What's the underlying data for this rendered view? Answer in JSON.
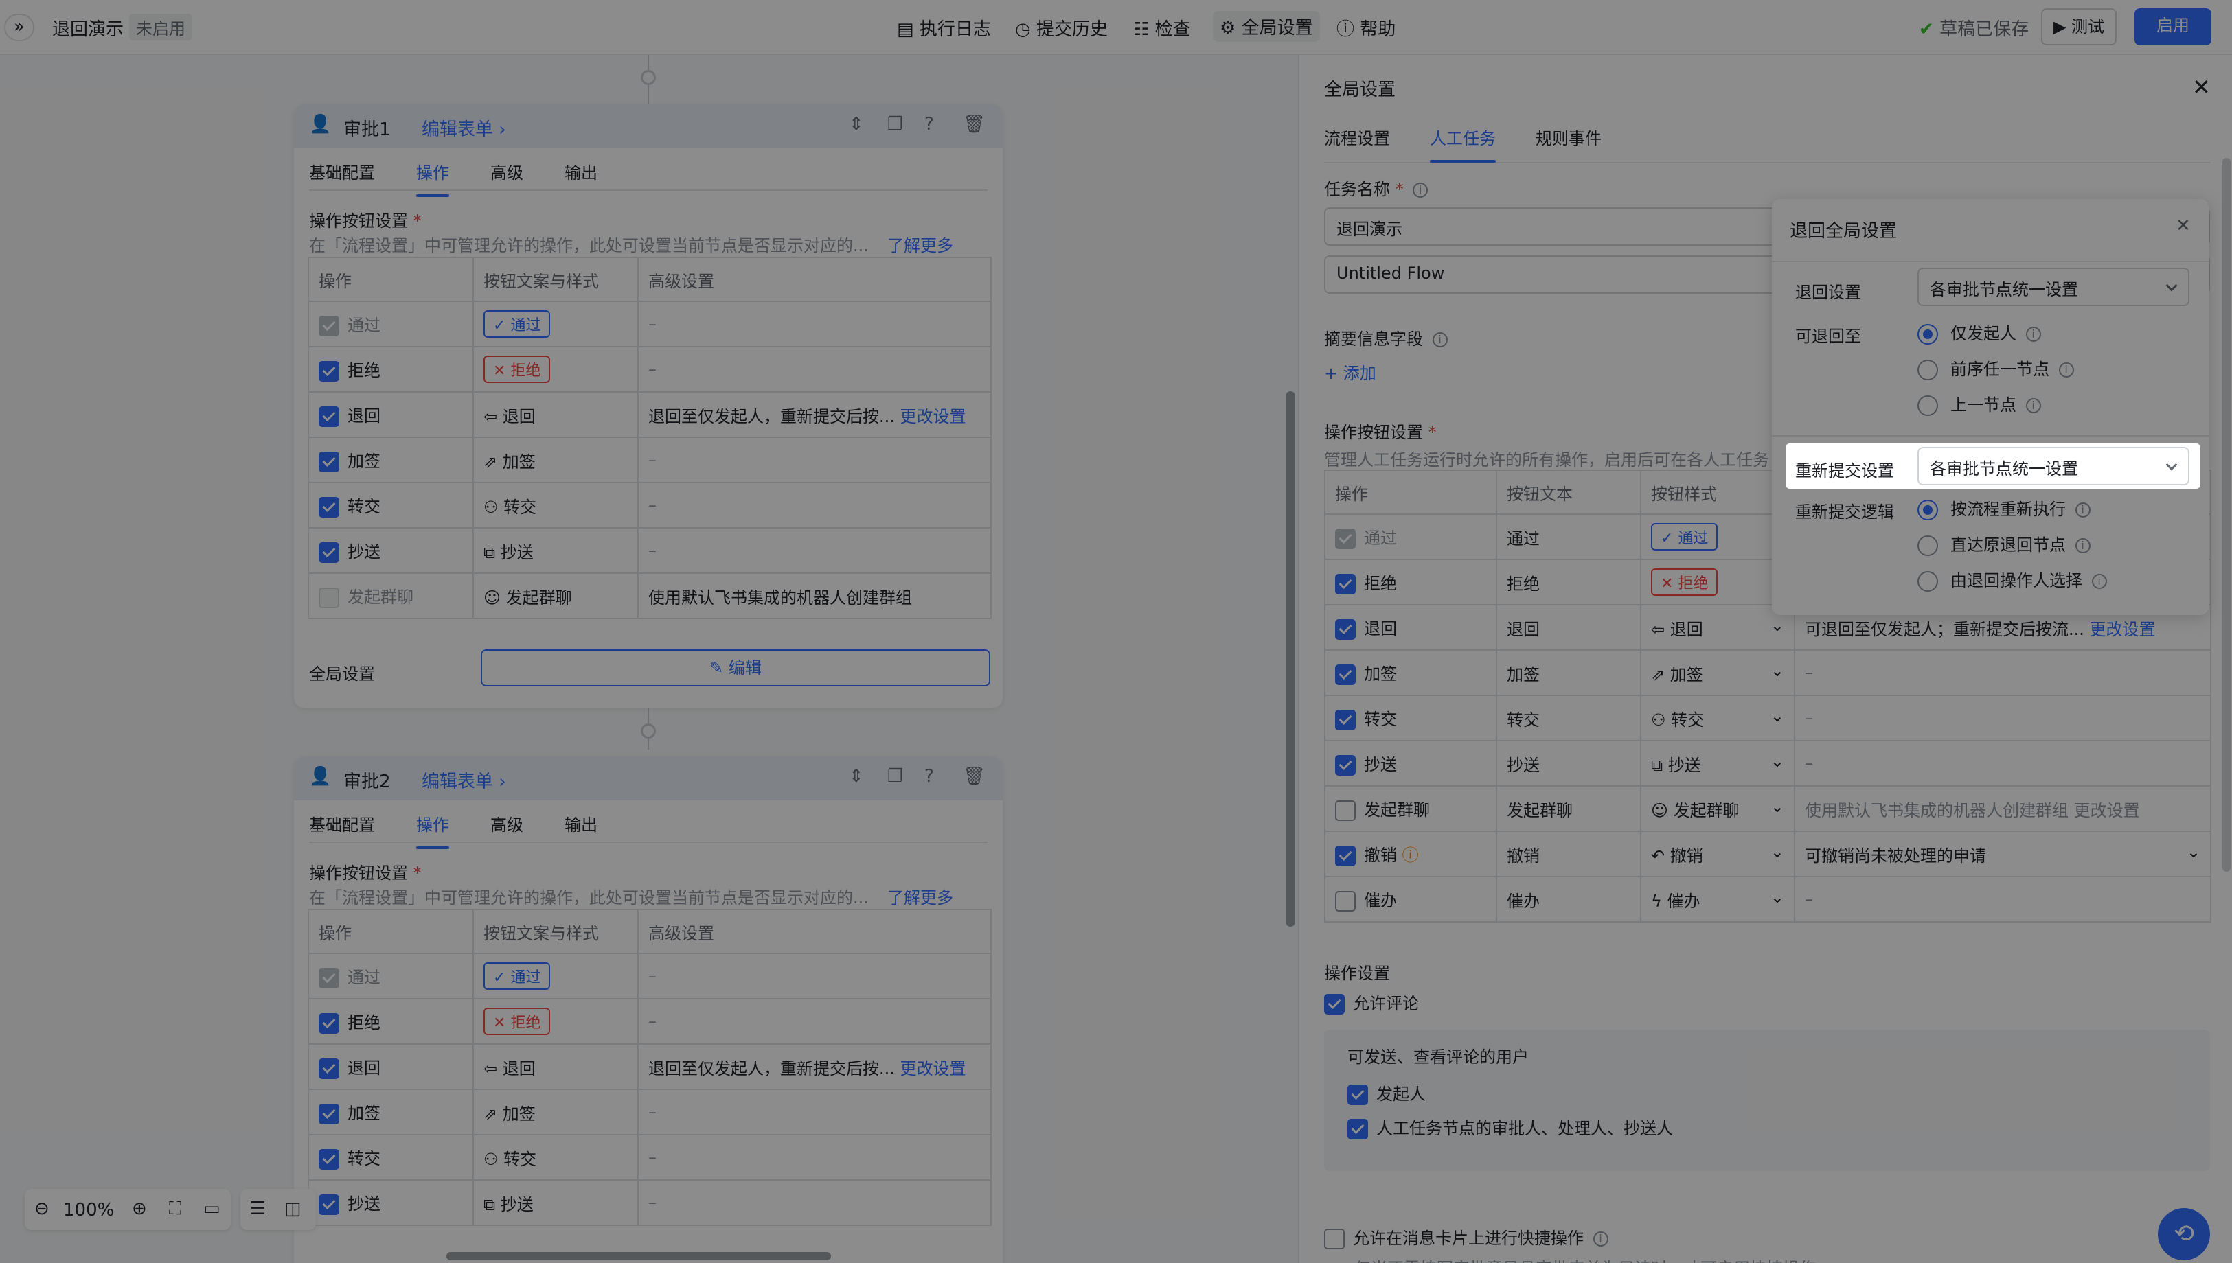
{
  "topbar": {
    "expand_icon": "»",
    "flow_name": "退回演示",
    "status": "未启用",
    "nav": [
      "执行日志",
      "提交历史",
      "检查",
      "全局设置",
      "帮助"
    ],
    "saved": "草稿已保存",
    "test": "测试",
    "enable": "启用"
  },
  "cards": [
    {
      "title": "审批1",
      "edit_form": "编辑表单",
      "tabs": [
        "基础配置",
        "操作",
        "高级",
        "输出"
      ],
      "section": "操作按钮设置",
      "desc": "在「流程设置」中可管理允许的操作，此处可设置当前节点是否显示对应的...",
      "learn_more": "了解更多",
      "headers": [
        "操作",
        "按钮文案与样式",
        "高级设置"
      ],
      "rows": [
        [
          "通过",
          "通过",
          "–"
        ],
        [
          "拒绝",
          "拒绝",
          "–"
        ],
        [
          "退回",
          "退回",
          "退回至仅发起人，重新提交后按..."
        ],
        [
          "加签",
          "加签",
          "–"
        ],
        [
          "转交",
          "转交",
          "–"
        ],
        [
          "抄送",
          "抄送",
          "–"
        ],
        [
          "发起群聊",
          "发起群聊",
          "使用默认飞书集成的机器人创建群组"
        ]
      ],
      "change_setting": "更改设置",
      "global_label": "全局设置",
      "edit_btn": "编辑"
    },
    {
      "title": "审批2",
      "edit_form": "编辑表单",
      "tabs": [
        "基础配置",
        "操作",
        "高级",
        "输出"
      ],
      "section": "操作按钮设置",
      "desc": "在「流程设置」中可管理允许的操作，此处可设置当前节点是否显示对应的...",
      "learn_more": "了解更多",
      "headers": [
        "操作",
        "按钮文案与样式",
        "高级设置"
      ],
      "rows": [
        [
          "通过",
          "通过",
          "–"
        ],
        [
          "拒绝",
          "拒绝",
          "–"
        ],
        [
          "退回",
          "退回",
          "退回至仅发起人，重新提交后按..."
        ],
        [
          "加签",
          "加签",
          "–"
        ],
        [
          "转交",
          "转交",
          "–"
        ],
        [
          "抄送",
          "抄送",
          "–"
        ]
      ],
      "change_setting": "更改设置"
    }
  ],
  "zoom": {
    "value": "100%"
  },
  "right": {
    "title": "全局设置",
    "tabs": [
      "流程设置",
      "人工任务",
      "规则事件"
    ],
    "task_name_label": "任务名称",
    "task_name": "退回演示",
    "flow_name": "Untitled Flow",
    "summary_label": "摘要信息字段",
    "add": "+ 添加",
    "ops_label": "操作按钮设置",
    "ops_desc": "管理人工任务运行时允许的所有操作，启用后可在各人工任务",
    "headers": [
      "操作",
      "按钮文本",
      "按钮样式"
    ],
    "rows": [
      {
        "op": "通过",
        "text": "通过",
        "style": "通过",
        "adv": ""
      },
      {
        "op": "拒绝",
        "text": "拒绝",
        "style": "拒绝",
        "adv": ""
      },
      {
        "op": "退回",
        "text": "退回",
        "style": "退回",
        "adv": "可退回至仅发起人；重新提交后按流..."
      },
      {
        "op": "加签",
        "text": "加签",
        "style": "加签",
        "adv": "–"
      },
      {
        "op": "转交",
        "text": "转交",
        "style": "转交",
        "adv": "–"
      },
      {
        "op": "抄送",
        "text": "抄送",
        "style": "抄送",
        "adv": "–"
      },
      {
        "op": "发起群聊",
        "text": "发起群聊",
        "style": "发起群聊",
        "adv": "使用默认飞书集成的机器人创建群组 更改设置"
      },
      {
        "op": "撤销",
        "text": "撤销",
        "style": "撤销",
        "adv": "可撤销尚未被处理的申请"
      },
      {
        "op": "催办",
        "text": "催办",
        "style": "催办",
        "adv": "–"
      }
    ],
    "change_setting": "更改设置",
    "op_settings": "操作设置",
    "allow_comment": "允许评论",
    "comment_users": "可发送、查看评论的用户",
    "user1": "发起人",
    "user2": "人工任务节点的审批人、处理人、抄送人",
    "quick_op": "允许在消息卡片上进行快捷操作",
    "quick_note": "仅当不需填写审批意见且审批表单为只读时，才可启用快捷操作。"
  },
  "popup": {
    "title": "退回全局设置",
    "return_setting_label": "退回设置",
    "return_setting": "各审批节点统一设置",
    "return_to_label": "可退回至",
    "options": [
      "仅发起人",
      "前序任一节点",
      "上一节点"
    ],
    "resubmit_label": "重新提交设置",
    "resubmit": "各审批节点统一设置",
    "logic_label": "重新提交逻辑",
    "logic_options": [
      "按流程重新执行",
      "直达原退回节点",
      "由退回操作人选择"
    ]
  }
}
